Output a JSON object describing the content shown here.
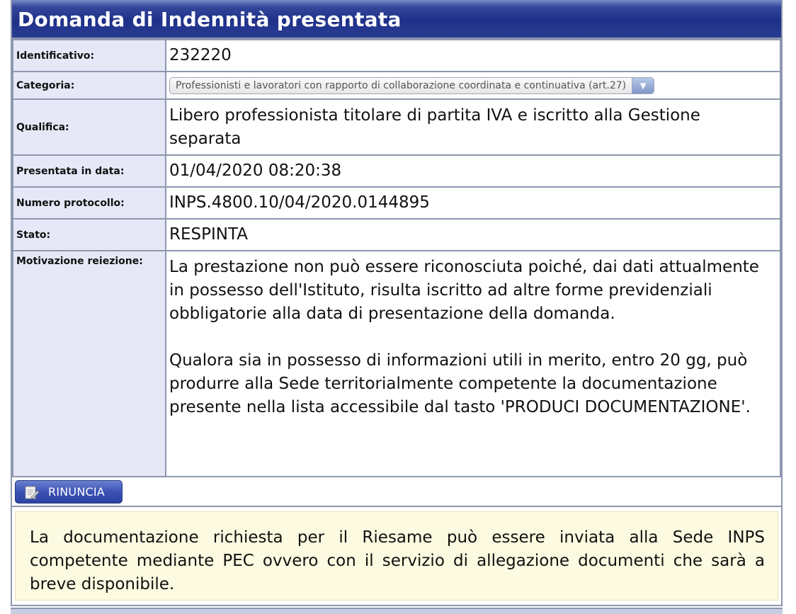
{
  "header": {
    "title": "Domanda di Indennità presentata"
  },
  "fields": {
    "identificativo": {
      "label": "Identificativo:",
      "value": "232220"
    },
    "categoria": {
      "label": "Categoria:",
      "selected": "Professionisti e lavoratori con rapporto di collaborazione coordinata e continuativa (art.27)",
      "arrow_icon": "chevron-down-icon"
    },
    "qualifica": {
      "label": "Qualifica:",
      "value": "Libero professionista titolare di partita IVA e iscritto alla Gestione separata"
    },
    "presentata": {
      "label": "Presentata in data:",
      "value": "01/04/2020 08:20:38"
    },
    "protocollo": {
      "label": "Numero protocollo:",
      "value": "INPS.4800.10/04/2020.0144895"
    },
    "stato": {
      "label": "Stato:",
      "value": "RESPINTA"
    },
    "motivazione": {
      "label": "Motivazione reiezione:",
      "paragraph1": "La prestazione non può essere riconosciuta poiché, dai dati attualmente in possesso dell'Istituto, risulta iscritto ad altre forme previdenziali obbligatorie alla data di presentazione della domanda.",
      "paragraph2": "Qualora sia in possesso di informazioni utili in merito, entro 20 gg, può produrre alla Sede territorialmente competente la documentazione presente nella lista accessibile dal tasto 'PRODUCI DOCUMENTAZIONE'."
    }
  },
  "actions": {
    "rinuncia_label": "RINUNCIA",
    "rinuncia_icon": "document-icon"
  },
  "notice": {
    "text": "La documentazione richiesta per il Riesame può essere inviata alla Sede INPS competente mediante PEC ovvero con il servizio di allegazione documenti che sarà a breve disponibile."
  },
  "colors": {
    "header_bg": "#1f3089",
    "label_bg": "#e6e8f7",
    "border": "#8e97b0",
    "button_bg": "#3b52b3",
    "notice_bg": "#fcfae0"
  }
}
